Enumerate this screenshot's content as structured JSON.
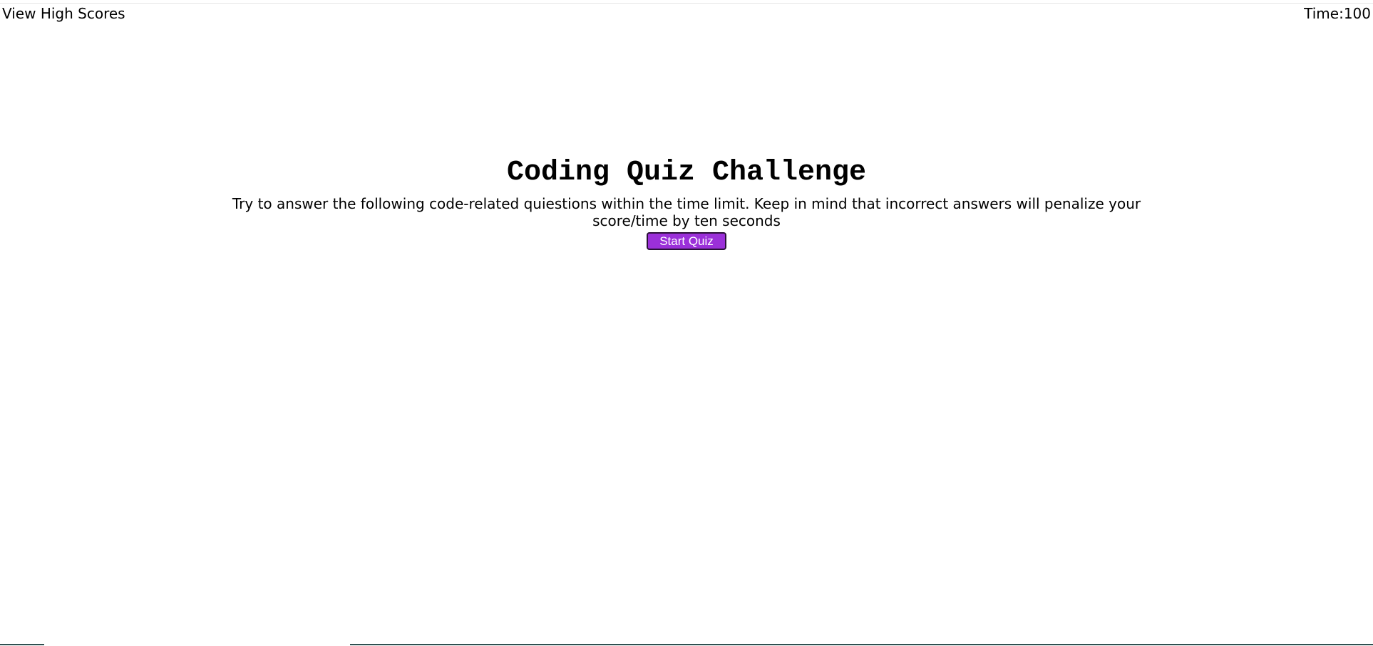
{
  "header": {
    "high_scores_label": "View High Scores",
    "timer_label": "Time:",
    "timer_value": "100"
  },
  "intro": {
    "title": "Coding Quiz Challenge",
    "description": "Try to answer the following code-related quiestions within the time limit. Keep in mind that incorrect answers will penalize your score/time by ten seconds",
    "start_button_label": "Start Quiz"
  },
  "colors": {
    "start_button_bg": "#9b30d9",
    "start_button_border": "#2b1038",
    "start_button_text": "#ffffff"
  }
}
